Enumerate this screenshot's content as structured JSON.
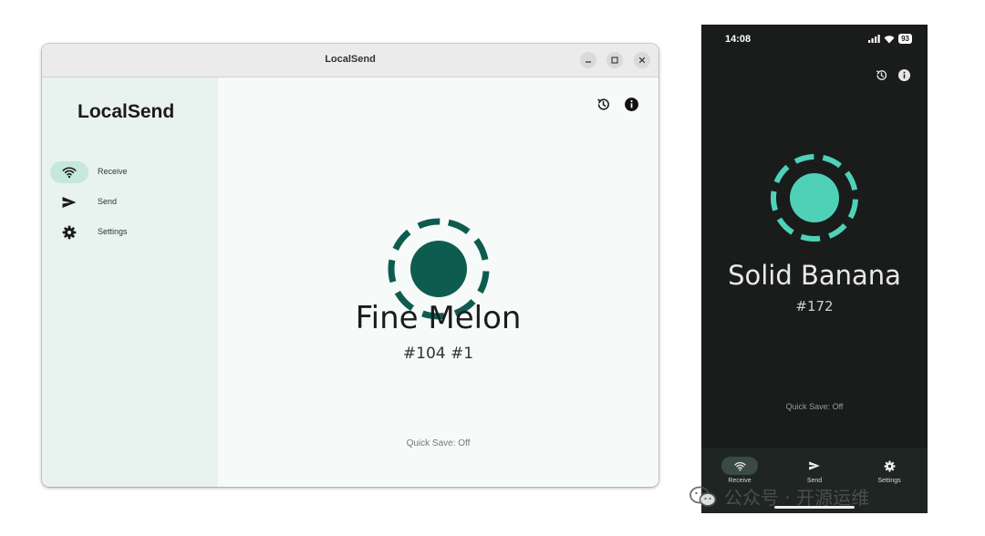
{
  "desktop": {
    "window_title": "LocalSend",
    "app_name": "LocalSend",
    "nav": [
      {
        "label": "Receive",
        "icon": "wifi-icon",
        "active": true
      },
      {
        "label": "Send",
        "icon": "send-icon",
        "active": false
      },
      {
        "label": "Settings",
        "icon": "gear-icon",
        "active": false
      }
    ],
    "device_name": "Fine Melon",
    "device_id": "#104 #1",
    "quick_save": "Quick Save: Off",
    "colors": {
      "accent": "#0e5c4f",
      "sidebar_bg": "#e8f3ef",
      "active_pill": "#c6e7dd"
    }
  },
  "phone": {
    "status_time": "14:08",
    "battery": "93",
    "device_name": "Solid Banana",
    "device_id": "#172",
    "quick_save": "Quick Save: Off",
    "nav": [
      {
        "label": "Receive",
        "icon": "wifi-icon",
        "active": true
      },
      {
        "label": "Send",
        "icon": "send-icon",
        "active": false
      },
      {
        "label": "Settings",
        "icon": "gear-icon",
        "active": false
      }
    ],
    "colors": {
      "accent": "#4fd1b8",
      "bg": "#191c1b"
    }
  },
  "watermark": {
    "text": "公众号 · 开源运维"
  }
}
